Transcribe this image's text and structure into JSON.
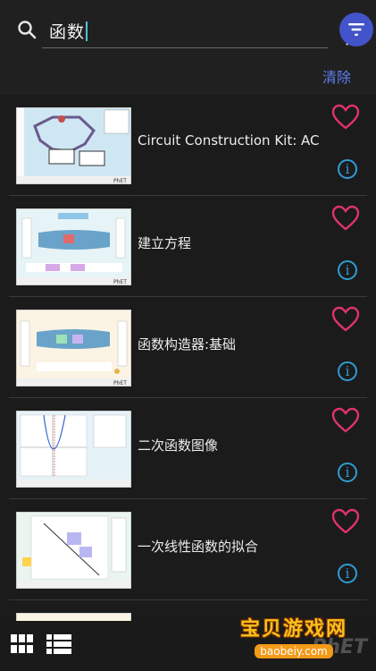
{
  "search": {
    "query": "函数",
    "clear_label": "清除"
  },
  "results": [
    {
      "title": "Circuit Construction Kit: AC",
      "thumb": "circuit"
    },
    {
      "title": "建立方程",
      "thumb": "equation"
    },
    {
      "title": "函数构造器:基础",
      "thumb": "function"
    },
    {
      "title": "二次函数图像",
      "thumb": "quadratic"
    },
    {
      "title": "一次线性函数的拟合",
      "thumb": "linear"
    }
  ],
  "watermark": {
    "title": "宝贝游戏网",
    "url": "baobeiy.com",
    "brand": "PhET"
  },
  "colors": {
    "accent": "#4353c9",
    "heart": "#e0336b",
    "info": "#2f9cd4",
    "link": "#5b7ff0"
  }
}
